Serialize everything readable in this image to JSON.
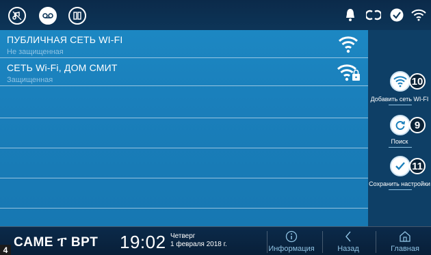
{
  "topbar": {
    "left_icons": [
      "music-mute-icon",
      "voicemail-icon",
      "door-mode-icon"
    ],
    "right_icons": [
      "bell-icon",
      "link-icon",
      "check-circle-icon",
      "wifi-status-icon"
    ]
  },
  "networks": [
    {
      "name": "ПУБЛИЧНАЯ СЕТЬ WI-FI",
      "security": "Не защищенная",
      "icon": "wifi-signal-icon"
    },
    {
      "name": "СЕТЬ Wi-Fi, ДОМ СМИТ",
      "security": "Защищенная",
      "icon": "wifi-locked-icon"
    }
  ],
  "side_actions": [
    {
      "label": "Добавить сеть WI-FI",
      "number": "10",
      "icon": "wifi-add-icon"
    },
    {
      "label": "Поиск",
      "number": "9",
      "icon": "refresh-icon"
    },
    {
      "label": "Сохранить настройки",
      "number": "11",
      "icon": "checkmark-icon"
    }
  ],
  "bottombar": {
    "brand_left": "CAME",
    "brand_right": "BPT",
    "time": "19:02",
    "weekday": "Четверг",
    "date": "1 февраля 2018 г.",
    "nav": [
      {
        "label": "Информация",
        "icon": "info-icon"
      },
      {
        "label": "Назад",
        "icon": "back-chevron-icon"
      },
      {
        "label": "Главная",
        "icon": "home-icon"
      }
    ]
  },
  "page_badge": "4",
  "colors": {
    "screen_blue": "#1a7fbb",
    "bar_navy": "#0b2a4a",
    "side_panel": "#0e3f66",
    "subtext": "#8fc3e4"
  }
}
